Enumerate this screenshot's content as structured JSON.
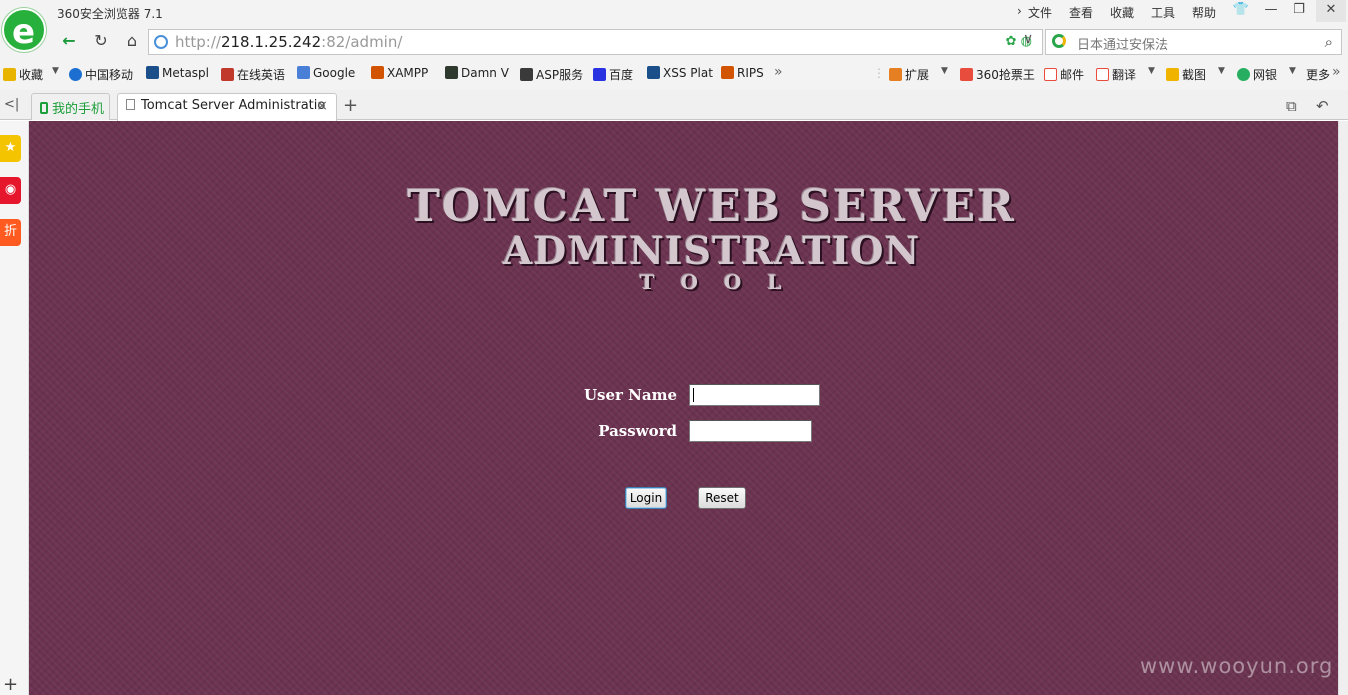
{
  "browser": {
    "title": "360安全浏览器 7.1",
    "menu": [
      "文件",
      "查看",
      "收藏",
      "工具",
      "帮助"
    ],
    "window_controls": {
      "skin": "👕",
      "minimize": "—",
      "maximize": "❐",
      "close": "✕"
    }
  },
  "address": {
    "url_scheme": "http://",
    "url_host": "218.1.25.242",
    "url_rest": ":82/admin/",
    "search_placeholder": "日本通过安保法"
  },
  "bookmarks": {
    "items": [
      {
        "label": "收藏",
        "color": "#e8b400"
      },
      {
        "label": "中国移动",
        "color": "#1c6fd1"
      },
      {
        "label": "Metaspl",
        "color": "#1a4f8a"
      },
      {
        "label": "在线英语",
        "color": "#c0392b"
      },
      {
        "label": "Google",
        "color": "#4a7fd8"
      },
      {
        "label": "XAMPP",
        "color": "#d35400"
      },
      {
        "label": "Damn V",
        "color": "#2e3a2e"
      },
      {
        "label": "ASP服务",
        "color": "#3a3a3a"
      },
      {
        "label": "百度",
        "color": "#2932e1"
      },
      {
        "label": "XSS Plat",
        "color": "#1a4f8a"
      },
      {
        "label": "RIPS",
        "color": "#d35400"
      }
    ],
    "more_chevron": "»",
    "right_items": [
      {
        "label": "扩展",
        "color": "#e67e22"
      },
      {
        "label": "360抢票王",
        "color": "#e74c3c"
      },
      {
        "label": "邮件",
        "color": "#e74c3c"
      },
      {
        "label": "翻译",
        "color": "#e74c3c"
      },
      {
        "label": "截图",
        "color": "#f0b400"
      },
      {
        "label": "网银",
        "color": "#27ae60"
      },
      {
        "label": "更多",
        "color": ""
      }
    ]
  },
  "tabs": {
    "phone_tab": "我的手机",
    "active_tab": "Tomcat Server Administratio",
    "close": "×",
    "add": "+"
  },
  "sidebar": {
    "items": [
      {
        "name": "favorites",
        "glyph": "★",
        "color": "#f5c400"
      },
      {
        "name": "weibo",
        "glyph": "◉",
        "color": "#e6162d"
      },
      {
        "name": "discount",
        "glyph": "折",
        "color": "#ff5a1f"
      }
    ],
    "add": "+"
  },
  "page": {
    "logo_line1": "TOMCAT WEB SERVER",
    "logo_line2": "ADMINISTRATION",
    "logo_line3": "TOOL",
    "username_label": "User Name",
    "password_label": "Password",
    "login_button": "Login",
    "reset_button": "Reset",
    "watermark": "www.wooyun.org",
    "background_color": "#6b3350"
  }
}
